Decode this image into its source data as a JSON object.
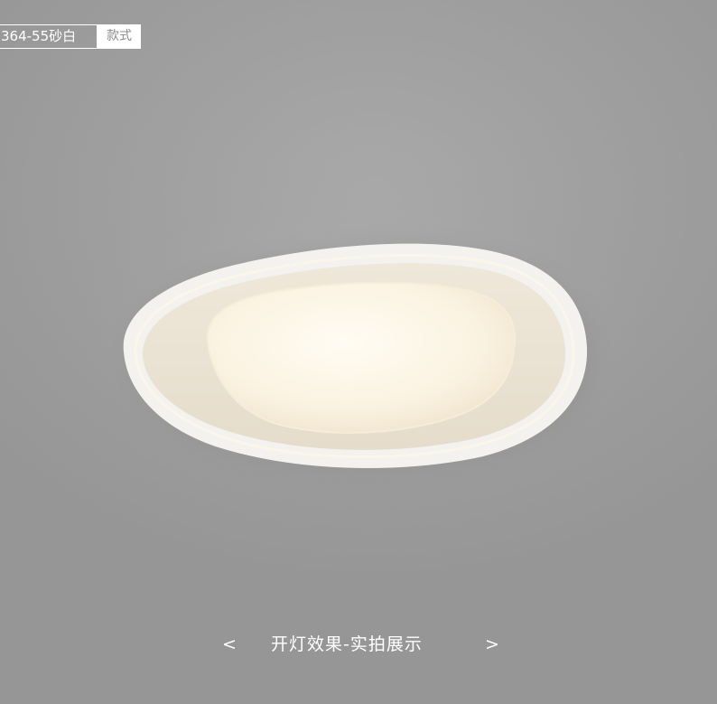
{
  "badge": {
    "model": "364-55砂白",
    "label": "款式"
  },
  "caption": {
    "prev": "<",
    "title": "开灯效果-实拍展示",
    "next": ">"
  },
  "photo": {
    "subject": "ceiling-lamp",
    "colors": {
      "ceiling": "#9e9e9e",
      "lamp_frame": "#f2f1ee",
      "light_glow": "#fdf7ea"
    }
  }
}
